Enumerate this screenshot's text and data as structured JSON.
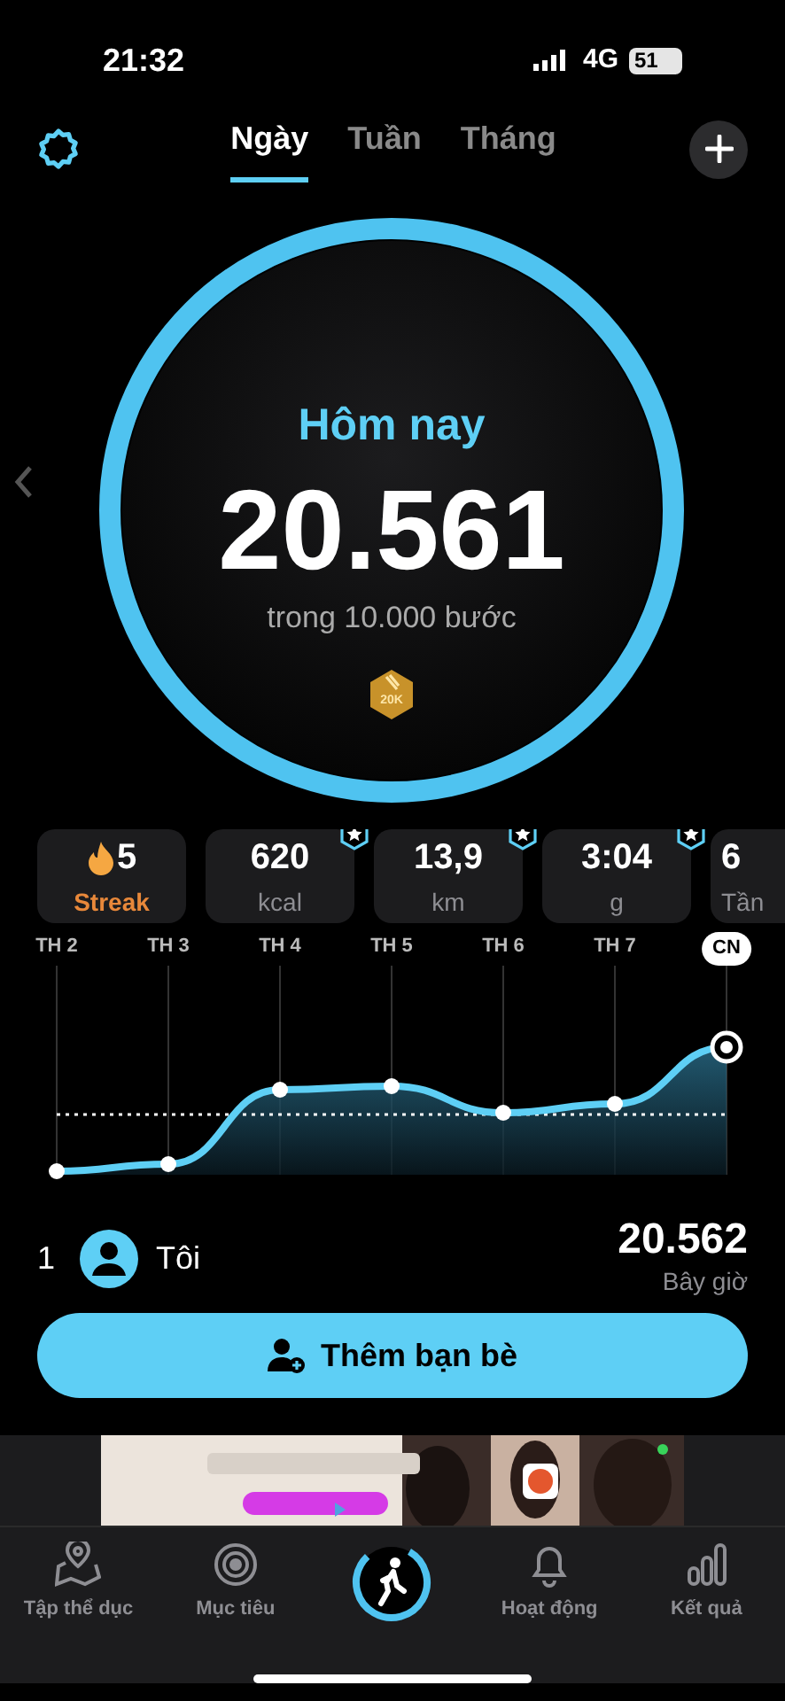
{
  "status_bar": {
    "time": "21:32",
    "network": "4G",
    "battery": "51"
  },
  "tabs": [
    {
      "label": "Ngày",
      "selected": true
    },
    {
      "label": "Tuần",
      "selected": false
    },
    {
      "label": "Tháng",
      "selected": false
    }
  ],
  "progress": {
    "title": "Hôm nay",
    "steps": "20.561",
    "goal": "trong 10.000 bước",
    "badge": "20K",
    "level": 1
  },
  "stats": [
    {
      "value": "5",
      "label": "Streak",
      "kind": "streak",
      "starred": false
    },
    {
      "value": "620",
      "label": "kcal",
      "kind": "metric",
      "starred": true
    },
    {
      "value": "13,9",
      "label": "km",
      "kind": "metric",
      "starred": true
    },
    {
      "value": "3:04",
      "label": "g",
      "kind": "metric",
      "starred": true
    },
    {
      "value": "6",
      "label": "Tần",
      "kind": "metric",
      "starred": false
    }
  ],
  "week": {
    "days": [
      {
        "label": "TH 2",
        "selected": false
      },
      {
        "label": "TH 3",
        "selected": false
      },
      {
        "label": "TH 4",
        "selected": false
      },
      {
        "label": "TH 5",
        "selected": false
      },
      {
        "label": "TH 6",
        "selected": false
      },
      {
        "label": "TH 7",
        "selected": false
      },
      {
        "label": "CN",
        "selected": true
      }
    ]
  },
  "leaderboard": [
    {
      "rank": "1",
      "name": "Tôi",
      "steps": "20.562",
      "time": "Bây giờ"
    }
  ],
  "add_friends_button": "Thêm bạn bè",
  "nav": [
    {
      "label": "Tập thể dục",
      "kind": "map",
      "selected": false
    },
    {
      "label": "Mục tiêu",
      "kind": "target",
      "selected": false
    },
    {
      "kind": "walk",
      "selected": true
    },
    {
      "label": "Hoạt động",
      "kind": "bell",
      "selected": false
    },
    {
      "label": "Kết quả",
      "kind": "bars",
      "selected": false
    }
  ]
}
